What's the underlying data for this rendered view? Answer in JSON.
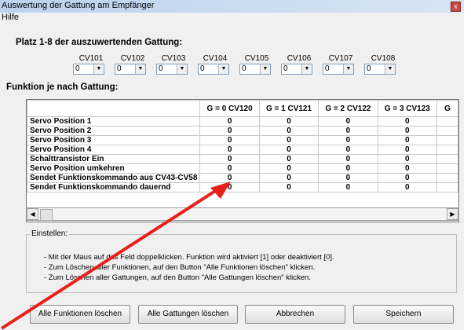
{
  "window": {
    "title": "Auswertung der Gattung am Empfänger",
    "close_glyph": "x"
  },
  "menu": {
    "items": [
      "Hilfe"
    ]
  },
  "section1": {
    "title": "Platz 1-8 der auszuwertenden Gattung:"
  },
  "cvs": [
    {
      "label": "CV101",
      "value": "0"
    },
    {
      "label": "CV102",
      "value": "0"
    },
    {
      "label": "CV103",
      "value": "0"
    },
    {
      "label": "CV104",
      "value": "0"
    },
    {
      "label": "CV105",
      "value": "0"
    },
    {
      "label": "CV106",
      "value": "0"
    },
    {
      "label": "CV107",
      "value": "0"
    },
    {
      "label": "CV108",
      "value": "0"
    }
  ],
  "section2": {
    "title": "Funktion je nach Gattung:"
  },
  "grid": {
    "headers": [
      "G = 0 CV120",
      "G = 1 CV121",
      "G = 2 CV122",
      "G = 3 CV123",
      "G"
    ],
    "rows": [
      {
        "label": "Servo Position 1",
        "values": [
          "0",
          "0",
          "0",
          "0"
        ]
      },
      {
        "label": "Servo Position 2",
        "values": [
          "0",
          "0",
          "0",
          "0"
        ]
      },
      {
        "label": "Servo Position 3",
        "values": [
          "0",
          "0",
          "0",
          "0"
        ]
      },
      {
        "label": "Servo Position 4",
        "values": [
          "0",
          "0",
          "0",
          "0"
        ]
      },
      {
        "label": "Schalttransistor Ein",
        "values": [
          "0",
          "0",
          "0",
          "0"
        ]
      },
      {
        "label": "Servo Position umkehren",
        "values": [
          "0",
          "0",
          "0",
          "0"
        ]
      },
      {
        "label": "Sendet Funktionskommando aus CV43-CV58",
        "values": [
          "0",
          "0",
          "0",
          "0"
        ]
      },
      {
        "label": "Sendet Funktionskommando dauernd",
        "values": [
          "0",
          "0",
          "0",
          "0"
        ]
      }
    ]
  },
  "settings": {
    "legend": "Einstellen:",
    "lines": [
      "- Mit der Maus auf das Feld doppelklicken. Funktion wird aktiviert [1] oder deaktiviert [0].",
      "- Zum Löschen aller Funktionen, auf den Button \"Alle Funktionen löschen\" klicken.",
      "- Zum Löschen aller Gattungen, auf den Button \"Alle Gattungen löschen\" klicken."
    ]
  },
  "buttons": {
    "clear_functions": "Alle Funktionen löschen",
    "clear_types": "Alle Gattungen löschen",
    "cancel": "Abbrechen",
    "save": "Speichern"
  },
  "colors": {
    "annotation_arrow": "#e8201a",
    "titlebar": "#bcd2ee"
  }
}
